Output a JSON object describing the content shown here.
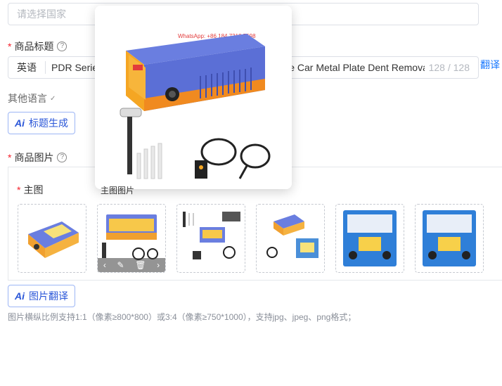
{
  "country": {
    "placeholder": "请选择国家"
  },
  "product_title": {
    "label": "商品标题",
    "language": "英语",
    "value": "PDR Series Car Body Dent Puller Spot Welder Machine Car Metal Plate Dent Removal Device",
    "counter": "128 / 128",
    "translate_link": "翻译"
  },
  "other_languages": {
    "label": "其他语言"
  },
  "ai_title_button": {
    "icon": "Ai",
    "label": "标题生成"
  },
  "product_images": {
    "label": "商品图片",
    "main_image_label": "主图",
    "hover_caption": "主图图片",
    "thumbnails": [
      {
        "alt": "dent puller unit angled view"
      },
      {
        "alt": "dent puller kit with hammer and cables"
      },
      {
        "alt": "dent puller kit with tools layout"
      },
      {
        "alt": "dent puller with accessories"
      },
      {
        "alt": "dent puller kit in blue case"
      },
      {
        "alt": "dent puller kit in blue case alternate"
      }
    ],
    "toolbar": {
      "left": "‹",
      "edit": "✎",
      "delete": "🗑",
      "right": "›"
    }
  },
  "ai_image_button": {
    "icon": "Ai",
    "label": "图片翻译"
  },
  "image_hint": "图片横纵比例支持1:1（像素≥800*800）或3:4（像素≥750*1000），支持jpg、jpeg、png格式；",
  "preview_watermark": "WhatsApp: +86 184 7318 7598",
  "colors": {
    "accent": "#2a56d8",
    "device_orange": "#f5a623",
    "device_blue": "#5b6fd6",
    "required": "#f5222d"
  }
}
